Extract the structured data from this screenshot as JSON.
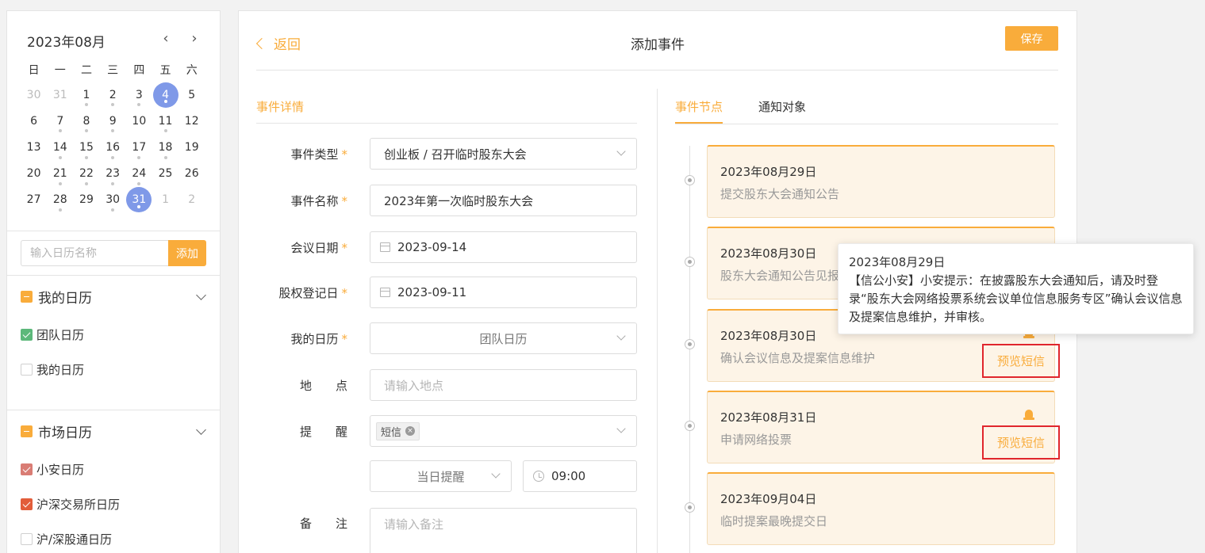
{
  "calendar": {
    "month_label": "2023年08月",
    "weekdays": [
      "日",
      "一",
      "二",
      "三",
      "四",
      "五",
      "六"
    ],
    "days": [
      {
        "n": "30",
        "muted": true,
        "dot": false,
        "sel": false
      },
      {
        "n": "31",
        "muted": true,
        "dot": false,
        "sel": false
      },
      {
        "n": "1",
        "muted": false,
        "dot": true,
        "sel": false
      },
      {
        "n": "2",
        "muted": false,
        "dot": true,
        "sel": false
      },
      {
        "n": "3",
        "muted": false,
        "dot": true,
        "sel": false
      },
      {
        "n": "4",
        "muted": false,
        "dot": true,
        "sel": true
      },
      {
        "n": "5",
        "muted": false,
        "dot": false,
        "sel": false
      },
      {
        "n": "6",
        "muted": false,
        "dot": false,
        "sel": false
      },
      {
        "n": "7",
        "muted": false,
        "dot": true,
        "sel": false
      },
      {
        "n": "8",
        "muted": false,
        "dot": true,
        "sel": false
      },
      {
        "n": "9",
        "muted": false,
        "dot": true,
        "sel": false
      },
      {
        "n": "10",
        "muted": false,
        "dot": false,
        "sel": false
      },
      {
        "n": "11",
        "muted": false,
        "dot": true,
        "sel": false
      },
      {
        "n": "12",
        "muted": false,
        "dot": false,
        "sel": false
      },
      {
        "n": "13",
        "muted": false,
        "dot": false,
        "sel": false
      },
      {
        "n": "14",
        "muted": false,
        "dot": true,
        "sel": false
      },
      {
        "n": "15",
        "muted": false,
        "dot": true,
        "sel": false
      },
      {
        "n": "16",
        "muted": false,
        "dot": true,
        "sel": false
      },
      {
        "n": "17",
        "muted": false,
        "dot": true,
        "sel": false
      },
      {
        "n": "18",
        "muted": false,
        "dot": true,
        "sel": false
      },
      {
        "n": "19",
        "muted": false,
        "dot": false,
        "sel": false
      },
      {
        "n": "20",
        "muted": false,
        "dot": false,
        "sel": false
      },
      {
        "n": "21",
        "muted": false,
        "dot": true,
        "sel": false
      },
      {
        "n": "22",
        "muted": false,
        "dot": true,
        "sel": false
      },
      {
        "n": "23",
        "muted": false,
        "dot": true,
        "sel": false
      },
      {
        "n": "24",
        "muted": false,
        "dot": true,
        "sel": false
      },
      {
        "n": "25",
        "muted": false,
        "dot": false,
        "sel": false
      },
      {
        "n": "26",
        "muted": false,
        "dot": false,
        "sel": false
      },
      {
        "n": "27",
        "muted": false,
        "dot": false,
        "sel": false
      },
      {
        "n": "28",
        "muted": false,
        "dot": true,
        "sel": false
      },
      {
        "n": "29",
        "muted": false,
        "dot": false,
        "sel": false
      },
      {
        "n": "30",
        "muted": false,
        "dot": true,
        "sel": false
      },
      {
        "n": "31",
        "muted": false,
        "dot": true,
        "sel": true
      },
      {
        "n": "1",
        "muted": true,
        "dot": false,
        "sel": false
      },
      {
        "n": "2",
        "muted": true,
        "dot": false,
        "sel": false
      }
    ],
    "nav_prev_icon": "chevron-left-icon",
    "nav_next_icon": "chevron-right-icon"
  },
  "calendar_add": {
    "placeholder": "输入日历名称",
    "button_label": "添加"
  },
  "my_calendars": {
    "title": "我的日历",
    "items": [
      {
        "label": "团队日历",
        "checked": true,
        "color": "#5cb87a"
      },
      {
        "label": "我的日历",
        "checked": false,
        "color": "#ffffff"
      }
    ]
  },
  "market_calendars": {
    "title": "市场日历",
    "items": [
      {
        "label": "小安日历",
        "checked": true,
        "color": "#d97c74"
      },
      {
        "label": "沪深交易所日历",
        "checked": true,
        "color": "#e25d3a"
      },
      {
        "label": "沪/深股通日历",
        "checked": false,
        "color": "#ffffff"
      }
    ]
  },
  "header": {
    "back_label": "返回",
    "title": "添加事件",
    "save_label": "保存"
  },
  "form": {
    "section_title": "事件详情",
    "event_type": {
      "label": "事件类型",
      "value": "创业板 / 召开临时股东大会"
    },
    "event_name": {
      "label": "事件名称",
      "value": "2023年第一次临时股东大会"
    },
    "meeting_date": {
      "label": "会议日期",
      "value": "2023-09-14"
    },
    "record_date": {
      "label": "股权登记日",
      "value": "2023-09-11"
    },
    "my_calendar": {
      "label": "我的日历",
      "value": "团队日历"
    },
    "location": {
      "label": "地　　点",
      "placeholder": "请输入地点"
    },
    "reminder": {
      "label": "提　　醒",
      "tag": "短信",
      "day_value": "当日提醒",
      "time_value": "09:00"
    },
    "note": {
      "label": "备　　注",
      "placeholder": "请输入备注"
    },
    "required_mark": "*"
  },
  "timeline": {
    "tabs": [
      "事件节点",
      "通知对象"
    ],
    "active_tab": 0,
    "nodes": [
      {
        "date": "2023年08月29日",
        "text": "提交股东大会通知公告",
        "bell": false,
        "preview": ""
      },
      {
        "date": "2023年08月30日",
        "text": "股东大会通知公告见报",
        "bell": false,
        "preview": ""
      },
      {
        "date": "2023年08月30日",
        "text": "确认会议信息及提案信息维护",
        "bell": true,
        "preview": "预览短信"
      },
      {
        "date": "2023年08月31日",
        "text": "申请网络投票",
        "bell": true,
        "preview": "预览短信"
      },
      {
        "date": "2023年09月04日",
        "text": "临时提案最晚提交日",
        "bell": false,
        "preview": ""
      }
    ]
  },
  "tooltip": {
    "date": "2023年08月29日",
    "text": "【信公小安】小安提示：在披露股东大会通知后，请及时登录“股东大会网络投票系统会议单位信息服务专区”确认会议信息及提案信息维护，并审核。"
  },
  "colors": {
    "accent": "#f9ac3b",
    "selected_day": "#7f99e8",
    "highlight_border": "#e0262d",
    "card_bg": "#fdf4e7"
  }
}
